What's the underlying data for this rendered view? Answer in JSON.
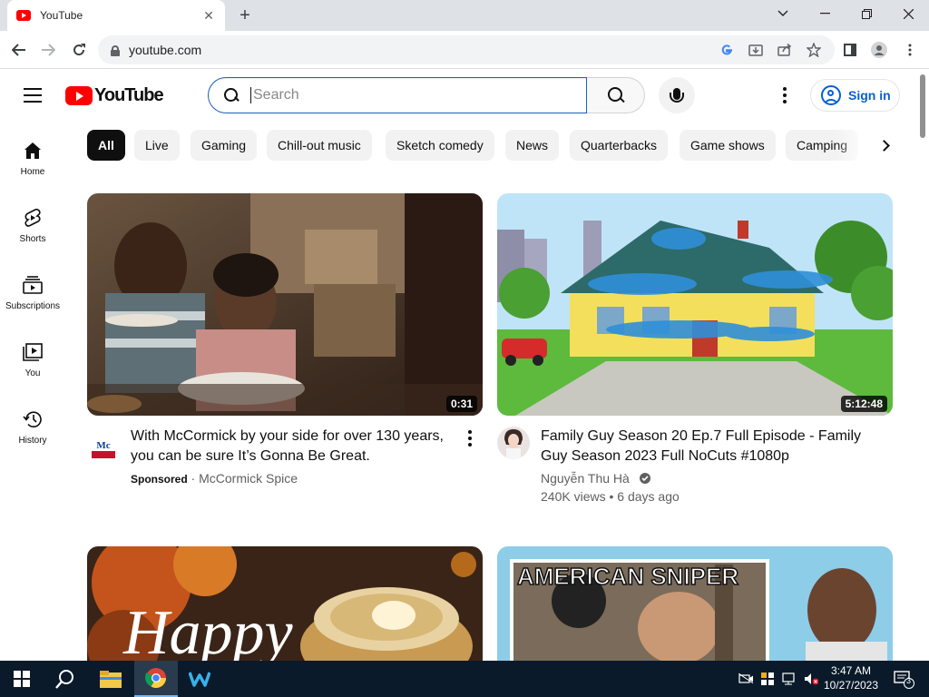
{
  "browser": {
    "tab_title": "YouTube",
    "url": "youtube.com"
  },
  "header": {
    "logo_text": "YouTube",
    "search_placeholder": "Search",
    "signin_label": "Sign in"
  },
  "guide": [
    {
      "label": "Home",
      "icon": "home-icon"
    },
    {
      "label": "Shorts",
      "icon": "shorts-icon"
    },
    {
      "label": "Subscriptions",
      "icon": "subscriptions-icon"
    },
    {
      "label": "You",
      "icon": "you-icon"
    },
    {
      "label": "History",
      "icon": "history-icon"
    }
  ],
  "chips": [
    "All",
    "Live",
    "Gaming",
    "Chill-out music",
    "Sketch comedy",
    "News",
    "Quarterbacks",
    "Game shows",
    "Camping"
  ],
  "videos": [
    {
      "title": "With McCormick by your side for over 130 years, you can be sure It’s Gonna Be Great.",
      "duration": "0:31",
      "sponsored_label": "Sponsored",
      "separator": " · ",
      "channel": "McCormick Spice"
    },
    {
      "title": "Family Guy Season 20 Ep.7 Full Episode - Family Guy Season 2023 Full NoCuts #1080p",
      "duration": "5:12:48",
      "channel": "Nguyễn Thu Hà",
      "views": "240K views",
      "separator": " • ",
      "age": "6 days ago"
    },
    {
      "thumb_text": "Happy"
    },
    {
      "thumb_text": "AMERICAN SNIPER"
    }
  ],
  "taskbar": {
    "time": "3:47 AM",
    "date": "10/27/2023",
    "notification_count": "3"
  },
  "colors": {
    "accent_blue": "#065fd4",
    "youtube_red": "#ff0000",
    "chip_bg": "#f2f2f2"
  }
}
